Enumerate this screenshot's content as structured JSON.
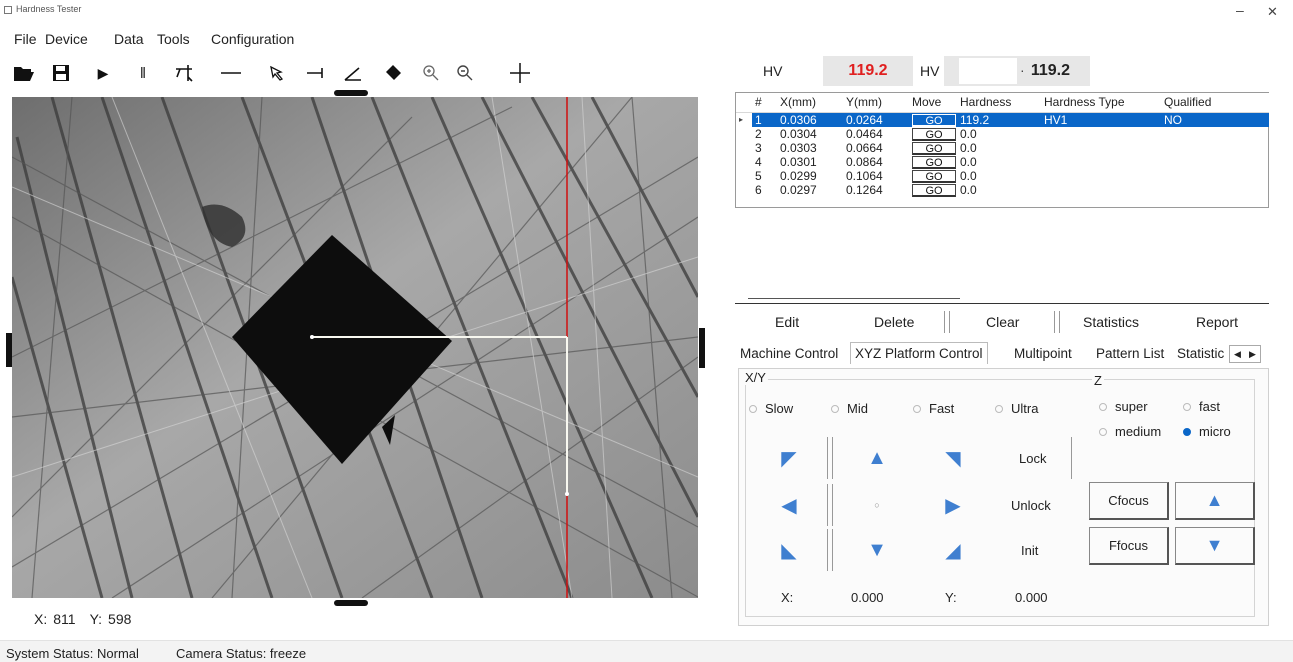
{
  "window": {
    "title": "Hardness Tester"
  },
  "menu": [
    "File",
    "Device",
    "Data",
    "Tools",
    "Configuration"
  ],
  "toolbar_icons": [
    "open-folder-icon",
    "save-icon",
    "play-icon",
    "pause-icon",
    "measure-icon",
    "line-icon",
    "select-arrow-icon",
    "horizontal-measure-icon",
    "angle-icon",
    "eraser-icon",
    "zoom-in-icon",
    "zoom-out-icon",
    "crosshair-icon"
  ],
  "hardness": {
    "label1": "HV",
    "value1": "119.2",
    "label2": "HV",
    "input_value": "",
    "dot": "·",
    "value2": "119.2",
    "value1_color": "#e02020"
  },
  "table": {
    "headers": [
      "#",
      "X(mm)",
      "Y(mm)",
      "Move",
      "Hardness",
      "Hardness Type",
      "Qualified"
    ],
    "rows": [
      {
        "n": "1",
        "x": "0.0306",
        "y": "0.0264",
        "move": "GO",
        "hardness": "119.2",
        "type": "HV1",
        "qualified": "NO"
      },
      {
        "n": "2",
        "x": "0.0304",
        "y": "0.0464",
        "move": "GO",
        "hardness": "0.0",
        "type": "",
        "qualified": ""
      },
      {
        "n": "3",
        "x": "0.0303",
        "y": "0.0664",
        "move": "GO",
        "hardness": "0.0",
        "type": "",
        "qualified": ""
      },
      {
        "n": "4",
        "x": "0.0301",
        "y": "0.0864",
        "move": "GO",
        "hardness": "0.0",
        "type": "",
        "qualified": ""
      },
      {
        "n": "5",
        "x": "0.0299",
        "y": "0.1064",
        "move": "GO",
        "hardness": "0.0",
        "type": "",
        "qualified": ""
      },
      {
        "n": "6",
        "x": "0.0297",
        "y": "0.1264",
        "move": "GO",
        "hardness": "0.0",
        "type": "",
        "qualified": ""
      }
    ]
  },
  "actions": {
    "edit": "Edit",
    "delete": "Delete",
    "clear": "Clear",
    "statistics": "Statistics",
    "report": "Report"
  },
  "tabs": [
    "Machine Control",
    "XYZ Platform Control",
    "Multipoint",
    "Pattern List",
    "Statistic"
  ],
  "xyz": {
    "xy_label": "X/Y",
    "z_label": "Z",
    "speeds": [
      "Slow",
      "Mid",
      "Fast",
      "Ultra"
    ],
    "speed_selected": "Ultra",
    "z_speeds": [
      "super",
      "fast",
      "medium",
      "micro"
    ],
    "z_selected": "micro",
    "lock": "Lock",
    "unlock": "Unlock",
    "init": "Init",
    "cfocus": "Cfocus",
    "ffocus": "Ffocus",
    "x_label": "X:",
    "x_value": "0.000",
    "y_label": "Y:",
    "y_value": "0.000"
  },
  "cursor": {
    "x_label": "X:",
    "x": "811",
    "y_label": "Y:",
    "y": "598"
  },
  "status": {
    "system": "System Status: Normal",
    "camera": "Camera Status: freeze"
  }
}
